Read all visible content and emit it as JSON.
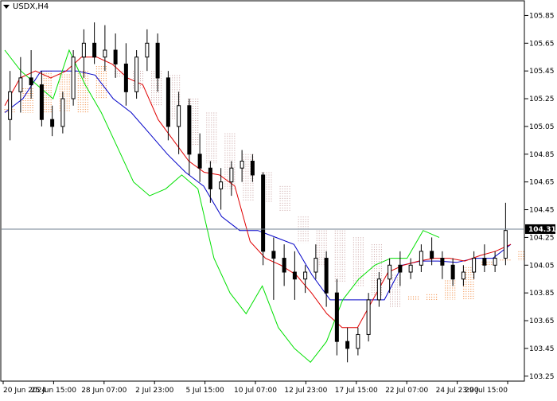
{
  "chart_data": {
    "type": "candlestick",
    "title": "USDX,H4",
    "current_price": "104.31",
    "ylim": [
      103.22,
      105.95
    ],
    "y_ticks": [
      "105.85",
      "105.65",
      "105.45",
      "105.25",
      "105.05",
      "104.85",
      "104.65",
      "104.45",
      "104.25",
      "104.05",
      "103.85",
      "103.65",
      "103.45",
      "103.25"
    ],
    "x_ticks": [
      "20 Jun 2024",
      "25 Jun 15:00",
      "28 Jun 07:00",
      "2 Jul 23:00",
      "5 Jul 15:00",
      "10 Jul 07:00",
      "12 Jul 23:00",
      "17 Jul 15:00",
      "22 Jul 07:00",
      "24 Jul 23:00",
      "29 Jul 15:00"
    ],
    "colors": {
      "tenkan": "#e00000",
      "kijun": "#0000c8",
      "chikou": "#00e000",
      "cloud_a": "#f08030",
      "cloud_b": "#c8a0a0",
      "candle": "#000000",
      "price_line": "#708090"
    },
    "candles": [
      [
        105.1,
        105.45,
        104.95,
        105.3
      ],
      [
        105.3,
        105.55,
        105.15,
        105.4
      ],
      [
        105.4,
        105.6,
        105.25,
        105.35
      ],
      [
        105.35,
        105.45,
        105.05,
        105.1
      ],
      [
        105.1,
        105.2,
        104.98,
        105.05
      ],
      [
        105.05,
        105.3,
        105.0,
        105.25
      ],
      [
        105.25,
        105.6,
        105.2,
        105.55
      ],
      [
        105.55,
        105.75,
        105.4,
        105.65
      ],
      [
        105.65,
        105.8,
        105.5,
        105.55
      ],
      [
        105.55,
        105.78,
        105.45,
        105.6
      ],
      [
        105.6,
        105.72,
        105.4,
        105.5
      ],
      [
        105.5,
        105.65,
        105.2,
        105.3
      ],
      [
        105.3,
        105.6,
        105.25,
        105.55
      ],
      [
        105.55,
        105.75,
        105.45,
        105.65
      ],
      [
        105.65,
        105.72,
        105.3,
        105.4
      ],
      [
        105.4,
        105.45,
        104.95,
        105.05
      ],
      [
        105.05,
        105.3,
        104.85,
        105.2
      ],
      [
        105.2,
        105.25,
        104.7,
        104.85
      ],
      [
        104.85,
        105.0,
        104.65,
        104.75
      ],
      [
        104.75,
        104.8,
        104.5,
        104.6
      ],
      [
        104.6,
        104.75,
        104.45,
        104.65
      ],
      [
        104.65,
        104.8,
        104.55,
        104.75
      ],
      [
        104.75,
        104.88,
        104.65,
        104.8
      ],
      [
        104.8,
        104.85,
        104.65,
        104.7
      ],
      [
        104.7,
        104.72,
        104.05,
        104.15
      ],
      [
        104.15,
        104.25,
        103.8,
        104.1
      ],
      [
        104.1,
        104.2,
        103.9,
        104.0
      ],
      [
        104.0,
        104.15,
        103.8,
        103.95
      ],
      [
        103.95,
        104.05,
        103.85,
        104.0
      ],
      [
        104.0,
        104.2,
        103.95,
        104.1
      ],
      [
        104.1,
        104.15,
        103.75,
        103.85
      ],
      [
        103.85,
        103.95,
        103.4,
        103.5
      ],
      [
        103.5,
        103.6,
        103.35,
        103.45
      ],
      [
        103.45,
        103.6,
        103.4,
        103.55
      ],
      [
        103.55,
        103.85,
        103.5,
        103.8
      ],
      [
        103.8,
        104.0,
        103.75,
        103.95
      ],
      [
        103.95,
        104.1,
        103.85,
        104.05
      ],
      [
        104.05,
        104.15,
        103.9,
        104.0
      ],
      [
        104.0,
        104.1,
        103.95,
        104.05
      ],
      [
        104.05,
        104.2,
        104.0,
        104.15
      ],
      [
        104.15,
        104.25,
        104.05,
        104.1
      ],
      [
        104.1,
        104.15,
        103.95,
        104.05
      ],
      [
        104.05,
        104.1,
        103.9,
        103.95
      ],
      [
        103.95,
        104.05,
        103.9,
        104.0
      ],
      [
        104.0,
        104.15,
        103.95,
        104.1
      ],
      [
        104.1,
        104.2,
        104.0,
        104.05
      ],
      [
        104.05,
        104.15,
        104.0,
        104.1
      ],
      [
        104.1,
        104.5,
        104.05,
        104.3
      ]
    ],
    "tenkan": [
      105.2,
      105.4,
      105.45,
      105.4,
      105.45,
      105.55,
      105.55,
      105.5,
      105.4,
      105.35,
      105.1,
      104.95,
      104.8,
      104.72,
      104.7,
      104.62,
      104.22,
      104.1,
      104.05,
      103.98,
      103.85,
      103.7,
      103.6,
      103.6,
      103.8,
      104.0,
      104.05,
      104.08,
      104.1,
      104.1,
      104.08,
      104.12,
      104.15,
      104.2
    ],
    "kijun": [
      105.15,
      105.25,
      105.45,
      105.45,
      105.45,
      105.42,
      105.25,
      105.15,
      105.0,
      104.85,
      104.72,
      104.62,
      104.4,
      104.3,
      104.3,
      104.25,
      104.2,
      103.98,
      103.8,
      103.8,
      103.8,
      103.8,
      104.05,
      104.08,
      104.08,
      104.07,
      104.1,
      104.1,
      104.2
    ],
    "chikou": [
      105.6,
      105.45,
      105.35,
      105.25,
      105.6,
      105.35,
      105.15,
      104.9,
      104.65,
      104.55,
      104.6,
      104.7,
      104.6,
      104.1,
      103.85,
      103.7,
      103.9,
      103.6,
      103.45,
      103.35,
      103.5,
      103.8,
      103.95,
      104.05,
      104.1,
      104.1,
      104.3,
      104.25
    ]
  }
}
